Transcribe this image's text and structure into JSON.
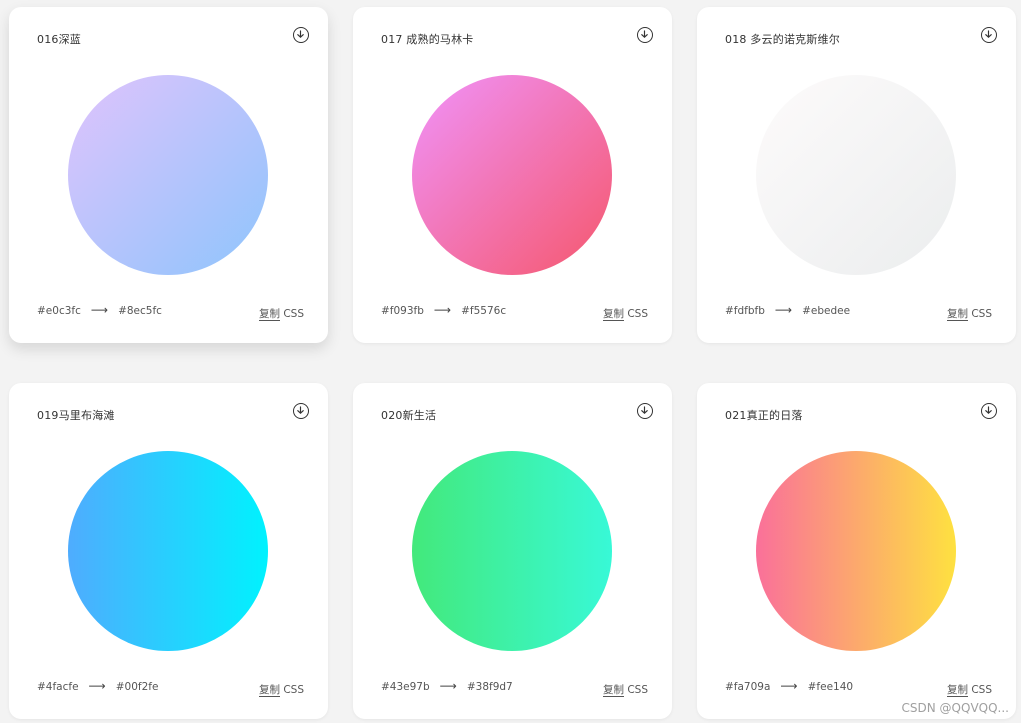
{
  "cards": [
    {
      "title": "016深蓝",
      "from": "#e0c3fc",
      "to": "#8ec5fc",
      "arrow": "⟶",
      "copy_label": "复制",
      "copy_suffix": " CSS",
      "gradient": "135deg",
      "colors": [
        "#e0c3fc",
        "#8ec5fc"
      ]
    },
    {
      "title": "017 成熟的马林卡",
      "from": "#f093fb",
      "to": "#f5576c",
      "arrow": "⟶",
      "copy_label": "复制",
      "copy_suffix": " CSS",
      "gradient": "135deg",
      "colors": [
        "#f093fb",
        "#f5576c"
      ]
    },
    {
      "title": "018 多云的诺克斯维尔",
      "from": "#fdfbfb",
      "to": "#ebedee",
      "arrow": "⟶",
      "copy_label": "复制",
      "copy_suffix": " CSS",
      "gradient": "135deg",
      "colors": [
        "#fdfbfb",
        "#ebedee"
      ]
    },
    {
      "title": "019马里布海滩",
      "from": "#4facfe",
      "to": "#00f2fe",
      "arrow": "⟶",
      "copy_label": "复制",
      "copy_suffix": " CSS",
      "gradient": "90deg",
      "colors": [
        "#4facfe",
        "#00f2fe"
      ]
    },
    {
      "title": "020新生活",
      "from": "#43e97b",
      "to": "#38f9d7",
      "arrow": "⟶",
      "copy_label": "复制",
      "copy_suffix": " CSS",
      "gradient": "90deg",
      "colors": [
        "#43e97b",
        "#38f9d7"
      ]
    },
    {
      "title": "021真正的日落",
      "from": "#fa709a",
      "to": "#fee140",
      "arrow": "⟶",
      "copy_label": "复制",
      "copy_suffix": " CSS",
      "gradient": "90deg",
      "colors": [
        "#fa709a",
        "#fee140"
      ]
    }
  ],
  "watermark": "CSDN @QQVQQ..."
}
